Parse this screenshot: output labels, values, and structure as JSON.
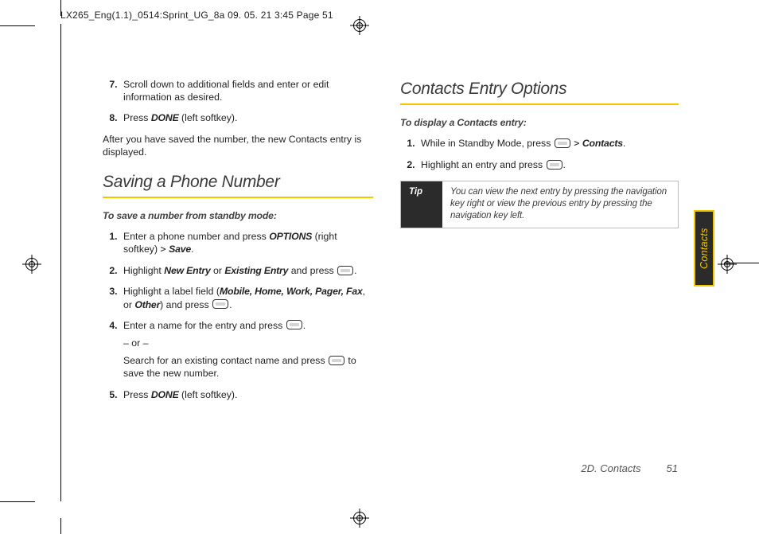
{
  "runningHead": "LX265_Eng(1.1)_0514:Sprint_UG_8a  09. 05. 21    3:45  Page 51",
  "left": {
    "stepsTop": [
      {
        "n": "7.",
        "text": "Scroll down to additional fields and enter or edit information as desired."
      },
      {
        "n": "8.",
        "pre": "Press ",
        "key": "DONE",
        "post": " (left softkey)."
      }
    ],
    "after": "After you have saved the number, the new Contacts entry is displayed.",
    "heading": "Saving a Phone Number",
    "intro": "To save a number from standby mode:",
    "steps": [
      {
        "n": "1.",
        "parts": [
          "Enter a phone number and press ",
          {
            "k": "OPTIONS"
          },
          " (right softkey) ",
          {
            "gt": ">"
          },
          " ",
          {
            "k": "Save"
          },
          "."
        ]
      },
      {
        "n": "2.",
        "parts": [
          "Highlight ",
          {
            "k": "New Entry"
          },
          " or ",
          {
            "k": "Existing Entry"
          },
          " and press ",
          {
            "ok": true
          },
          "."
        ]
      },
      {
        "n": "3.",
        "parts": [
          "Highlight a label field (",
          {
            "k": "Mobile, Home, Work, Pager, Fax"
          },
          ", or ",
          {
            "k": "Other"
          },
          ") and press ",
          {
            "ok": true
          },
          "."
        ]
      },
      {
        "n": "4.",
        "parts": [
          "Enter a name for the entry and press ",
          {
            "ok": true
          },
          "."
        ],
        "subs": [
          "– or –",
          [
            "Search for an existing contact name and press ",
            {
              "ok": true
            },
            " to save the new number."
          ]
        ]
      },
      {
        "n": "5.",
        "parts": [
          "Press ",
          {
            "k": "DONE"
          },
          " (left softkey)."
        ]
      }
    ]
  },
  "right": {
    "heading": "Contacts Entry Options",
    "intro": "To display a Contacts entry:",
    "steps": [
      {
        "n": "1.",
        "parts": [
          "While in Standby Mode, press ",
          {
            "ok": true
          },
          " ",
          {
            "gt": ">"
          },
          " ",
          {
            "k": "Contacts"
          },
          "."
        ]
      },
      {
        "n": "2.",
        "parts": [
          "Highlight an entry and press ",
          {
            "ok": true
          },
          "."
        ]
      }
    ],
    "tip": {
      "label": "Tip",
      "text": "You can view the next entry by pressing the navigation key right or view the previous entry by pressing the navigation key left."
    }
  },
  "thumbtab": "Contacts",
  "footer": {
    "section": "2D. Contacts",
    "page": "51"
  }
}
